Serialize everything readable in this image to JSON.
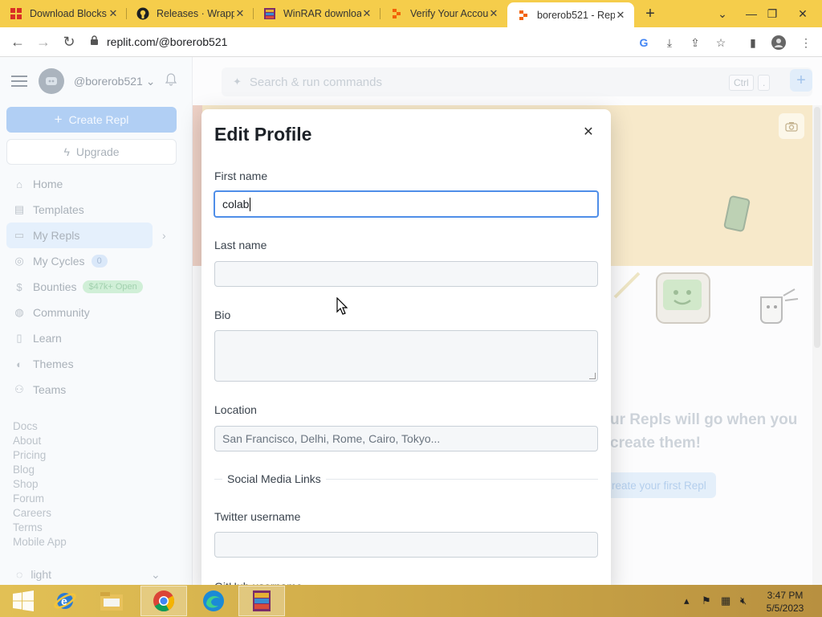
{
  "browser": {
    "tabs": [
      {
        "title": "Download Blocks: ",
        "icon": "blocks-favicon"
      },
      {
        "title": "Releases · Wrapp",
        "icon": "github-favicon"
      },
      {
        "title": "WinRAR download",
        "icon": "winrar-favicon"
      },
      {
        "title": "Verify Your Accou",
        "icon": "replit-favicon"
      },
      {
        "title": "borerob521 - Rep",
        "icon": "replit-favicon",
        "active": true
      }
    ],
    "url": "replit.com/@borerob521",
    "colors": {
      "tabstrip": "#f5cd4b",
      "taskbar": "#d8b34f"
    }
  },
  "sidebar": {
    "username": "@borerob521",
    "create_label": "Create Repl",
    "upgrade_label": "Upgrade",
    "nav": [
      {
        "label": "Home",
        "icon": "home-icon"
      },
      {
        "label": "Templates",
        "icon": "templates-icon"
      },
      {
        "label": "My Repls",
        "icon": "folder-icon"
      },
      {
        "label": "My Cycles",
        "icon": "cycles-icon",
        "badge": "0"
      },
      {
        "label": "Bounties",
        "icon": "dollar-icon",
        "badge": "$47k+ Open"
      },
      {
        "label": "Community",
        "icon": "globe-icon"
      },
      {
        "label": "Learn",
        "icon": "book-icon"
      },
      {
        "label": "Themes",
        "icon": "palette-icon"
      },
      {
        "label": "Teams",
        "icon": "people-icon"
      }
    ],
    "links": [
      "Docs",
      "About",
      "Pricing",
      "Blog",
      "Shop",
      "Forum",
      "Careers",
      "Terms",
      "Mobile App"
    ],
    "theme": "light"
  },
  "main": {
    "search_placeholder": "Search & run commands",
    "kbd_ctrl": "Ctrl",
    "kbd_dot": ".",
    "empty_message": "ur Repls will go when you create them!",
    "first_repl_label": "reate your first Repl"
  },
  "modal": {
    "title": "Edit Profile",
    "first_name_label": "First name",
    "first_name_value": "colab",
    "last_name_label": "Last name",
    "last_name_value": "",
    "bio_label": "Bio",
    "bio_value": "",
    "location_label": "Location",
    "location_placeholder": "San Francisco, Delhi, Rome, Cairo, Tokyo...",
    "social_heading": "Social Media Links",
    "twitter_label": "Twitter username",
    "twitter_value": "",
    "github_label": "GitHub username"
  },
  "taskbar": {
    "time": "3:47 PM",
    "date": "5/5/2023",
    "apps": [
      "windows-start-icon",
      "internet-explorer-icon",
      "file-explorer-icon",
      "chrome-icon",
      "edge-icon",
      "winrar-icon"
    ]
  }
}
